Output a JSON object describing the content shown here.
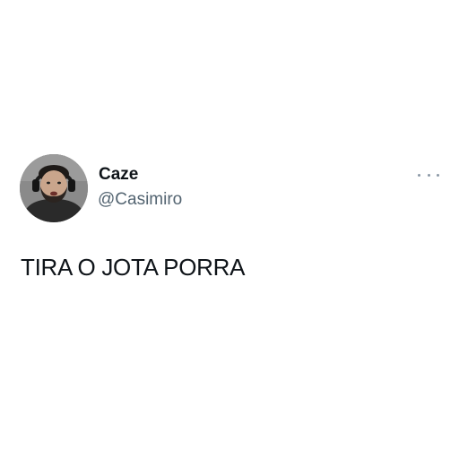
{
  "tweet": {
    "author": {
      "display_name": "Caze",
      "username": "@Casimiro",
      "avatar": "profile-photo"
    },
    "text": "TIRA O JOTA PORRA",
    "more_icon": "ellipsis-icon"
  },
  "colors": {
    "background": "#ffffff",
    "text_primary": "#0f1419",
    "text_secondary": "#536471",
    "icon_gray": "#8b98a5"
  }
}
